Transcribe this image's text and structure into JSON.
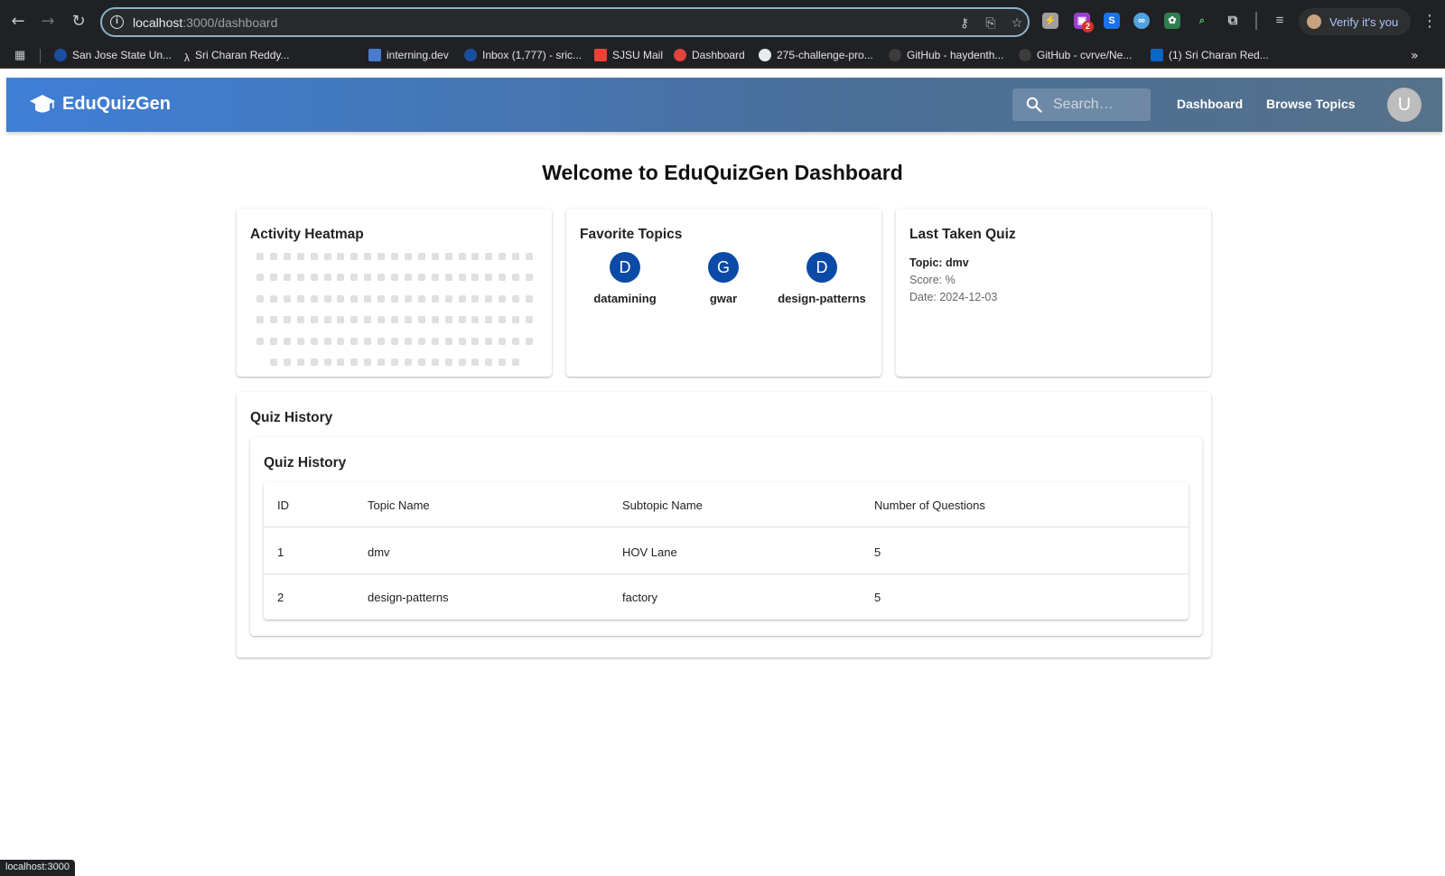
{
  "browser": {
    "url_host": "localhost",
    "url_path": ":3000/dashboard",
    "verify_label": "Verify it's you",
    "ext_badge": "2",
    "status_url": "localhost:3000",
    "bookmarks": [
      {
        "label": "San Jose State Un...",
        "color": "#1a4fa0"
      },
      {
        "label": "Sri Charan Reddy...",
        "color": "#202124"
      },
      {
        "label": "interning.dev",
        "color": "#4a7bd0"
      },
      {
        "label": "Inbox (1,777) - sric...",
        "color": "#1a4fa0"
      },
      {
        "label": "SJSU Mail",
        "color": "#ea4335"
      },
      {
        "label": "Dashboard",
        "color": "#e0443a"
      },
      {
        "label": "275-challenge-pro...",
        "color": "#e8eaed"
      },
      {
        "label": "GitHub - haydenth...",
        "color": "#3c3c3c"
      },
      {
        "label": "GitHub - cvrve/Ne...",
        "color": "#3c3c3c"
      },
      {
        "label": "(1) Sri Charan Red...",
        "color": "#0a66c2"
      }
    ]
  },
  "app": {
    "brand": "EduQuizGen",
    "search_placeholder": "Search…",
    "nav": {
      "dashboard": "Dashboard",
      "browse": "Browse Topics"
    },
    "avatar_initial": "U",
    "accent": "#3f7fd8"
  },
  "dashboard": {
    "title": "Welcome to EduQuizGen Dashboard",
    "heatmap": {
      "title": "Activity Heatmap"
    },
    "favorites": {
      "title": "Favorite Topics",
      "items": [
        {
          "initial": "D",
          "name": "datamining"
        },
        {
          "initial": "G",
          "name": "gwar"
        },
        {
          "initial": "D",
          "name": "design-patterns"
        }
      ]
    },
    "last_quiz": {
      "title": "Last Taken Quiz",
      "topic": "Topic: dmv",
      "score": "Score: %",
      "date": "Date: 2024-12-03"
    },
    "history": {
      "outer_title": "Quiz History",
      "inner_title": "Quiz History",
      "columns": [
        "ID",
        "Topic Name",
        "Subtopic Name",
        "Number of Questions"
      ],
      "rows": [
        [
          "1",
          "dmv",
          "HOV Lane",
          "5"
        ],
        [
          "2",
          "design-patterns",
          "factory",
          "5"
        ]
      ]
    }
  }
}
